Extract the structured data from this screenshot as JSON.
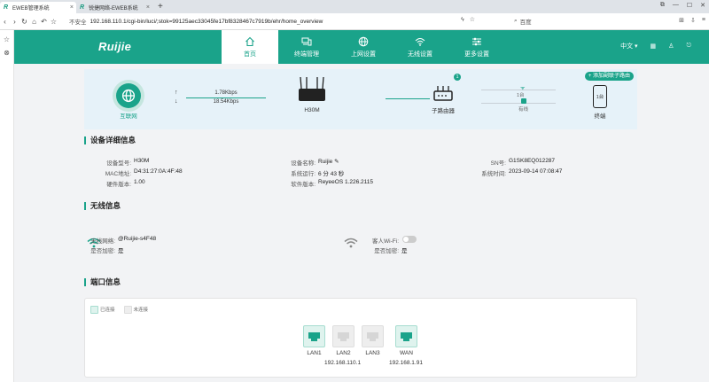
{
  "browser": {
    "tabs": [
      {
        "title": "EWEB管理系统",
        "active": true
      },
      {
        "title": "锐捷网络-EWEB系统",
        "active": false
      }
    ],
    "insecure_label": "不安全",
    "url": "192.168.110.1/cgi-bin/luci/;stok=99125aec33045fe17bf8328467c7919b/ehr/home_overview",
    "search_placeholder": "百度"
  },
  "app": {
    "logo": "Ruijie",
    "nav": [
      {
        "label": "首页",
        "icon": "home-icon",
        "active": true
      },
      {
        "label": "终端管理",
        "icon": "devices-icon",
        "active": false
      },
      {
        "label": "上网设置",
        "icon": "globe-icon",
        "active": false
      },
      {
        "label": "无线设置",
        "icon": "wifi-icon",
        "active": false
      },
      {
        "label": "更多设置",
        "icon": "sliders-icon",
        "active": false
      }
    ],
    "language": "中文"
  },
  "topology": {
    "internet_label": "互联网",
    "upload_speed": "1.78Kbps",
    "download_speed": "18.54Kbps",
    "router_label": "H30M",
    "sub_router_label": "子路由器",
    "sub_router_badge": "1",
    "wifi_label": "1台",
    "wired_label": "有线",
    "terminal_label": "终端",
    "terminal_count": "1台",
    "add_button": "+ 添加副联子路由"
  },
  "device_info": {
    "title": "设备详细信息",
    "rows": [
      {
        "label": "设备型号:",
        "value": "H30M"
      },
      {
        "label": "MAC地址:",
        "value": "D4:31:27:0A:4F:48"
      },
      {
        "label": "硬件版本:",
        "value": "1.00"
      },
      {
        "label": "设备名称:",
        "value": "Ruijie"
      },
      {
        "label": "系统运行:",
        "value": "6 分 43 秒"
      },
      {
        "label": "软件版本:",
        "value": "ReyeeOS 1.226.2115"
      },
      {
        "label": "SN号:",
        "value": "G1SK8EQ012287"
      },
      {
        "label": "系统时间:",
        "value": "2023-09-14 07:08:47"
      }
    ]
  },
  "wireless": {
    "title": "无线信息",
    "ssid_label": "无线网络:",
    "ssid_value": "@Ruijie-s4F48",
    "encrypt_label": "是否加密:",
    "encrypt_value": "是",
    "guest_label": "客人Wi-Fi:",
    "guest_encrypt_label": "是否加密:",
    "guest_encrypt_value": "是"
  },
  "ports": {
    "title": "端口信息",
    "legend_connected": "已连接",
    "legend_disconnected": "未连接",
    "items": [
      {
        "name": "LAN1",
        "connected": true
      },
      {
        "name": "LAN2",
        "connected": false
      },
      {
        "name": "LAN3",
        "connected": false
      },
      {
        "name": "WAN",
        "connected": true
      }
    ],
    "lan_ip": "192.168.110.1",
    "wan_ip": "192.168.1.91"
  },
  "colors": {
    "accent": "#1aa38a",
    "topo_bg": "#e6f2f9"
  }
}
